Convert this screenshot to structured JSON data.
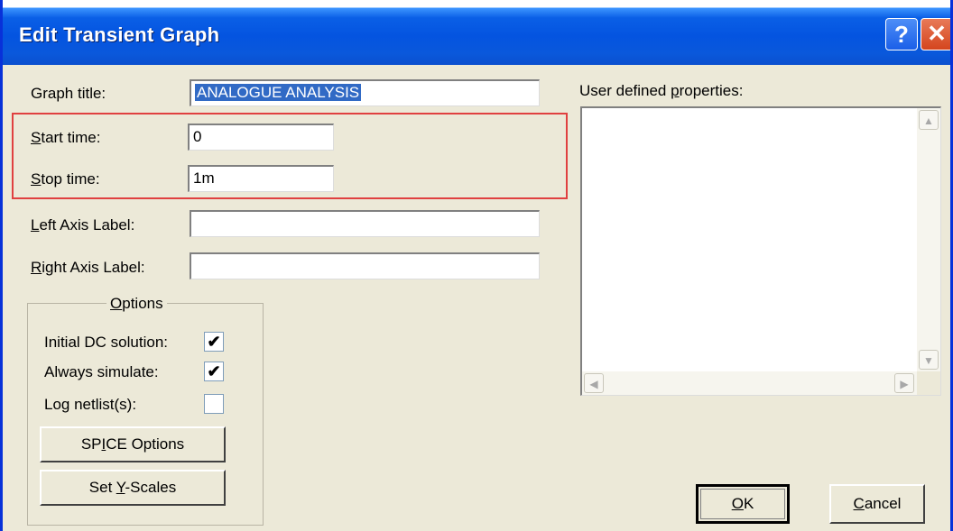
{
  "window": {
    "title": "Edit Transient Graph",
    "help_glyph": "?",
    "close_glyph": "✕"
  },
  "fields": {
    "graph_title": {
      "label": "Graph title:",
      "value": "ANALOGUE ANALYSIS"
    },
    "start_time": {
      "label_mnemonic": "S",
      "label_rest": "tart time:",
      "value": "0"
    },
    "stop_time": {
      "label_mnemonic": "S",
      "label_rest": "top time:",
      "value": "1m"
    },
    "left_axis": {
      "label_mnemonic": "L",
      "label_rest": "eft Axis Label:",
      "value": ""
    },
    "right_axis": {
      "label_mnemonic": "R",
      "label_rest": "ight Axis Label:",
      "value": ""
    }
  },
  "options": {
    "title_mnemonic": "O",
    "title_rest": "ptions",
    "initial_dc": {
      "label": "Initial DC solution:",
      "checked": true
    },
    "always_simulate": {
      "label": "Always simulate:",
      "checked": true
    },
    "log_netlists": {
      "label": "Log netlist(s):",
      "checked": false
    },
    "spice_button": {
      "pre": "SP",
      "mnemonic": "I",
      "post": "CE Options"
    },
    "yscales_button": {
      "pre": "Set ",
      "mnemonic": "Y",
      "post": "-Scales"
    }
  },
  "properties": {
    "label_pre": "User defined ",
    "label_mnemonic": "p",
    "label_post": "roperties:"
  },
  "buttons": {
    "ok": {
      "mnemonic": "O",
      "rest": "K"
    },
    "cancel": {
      "mnemonic": "C",
      "rest": "ancel"
    }
  },
  "check_glyph": "✔",
  "scroll_glyphs": {
    "up": "▲",
    "down": "▼",
    "left": "◀",
    "right": "▶"
  }
}
